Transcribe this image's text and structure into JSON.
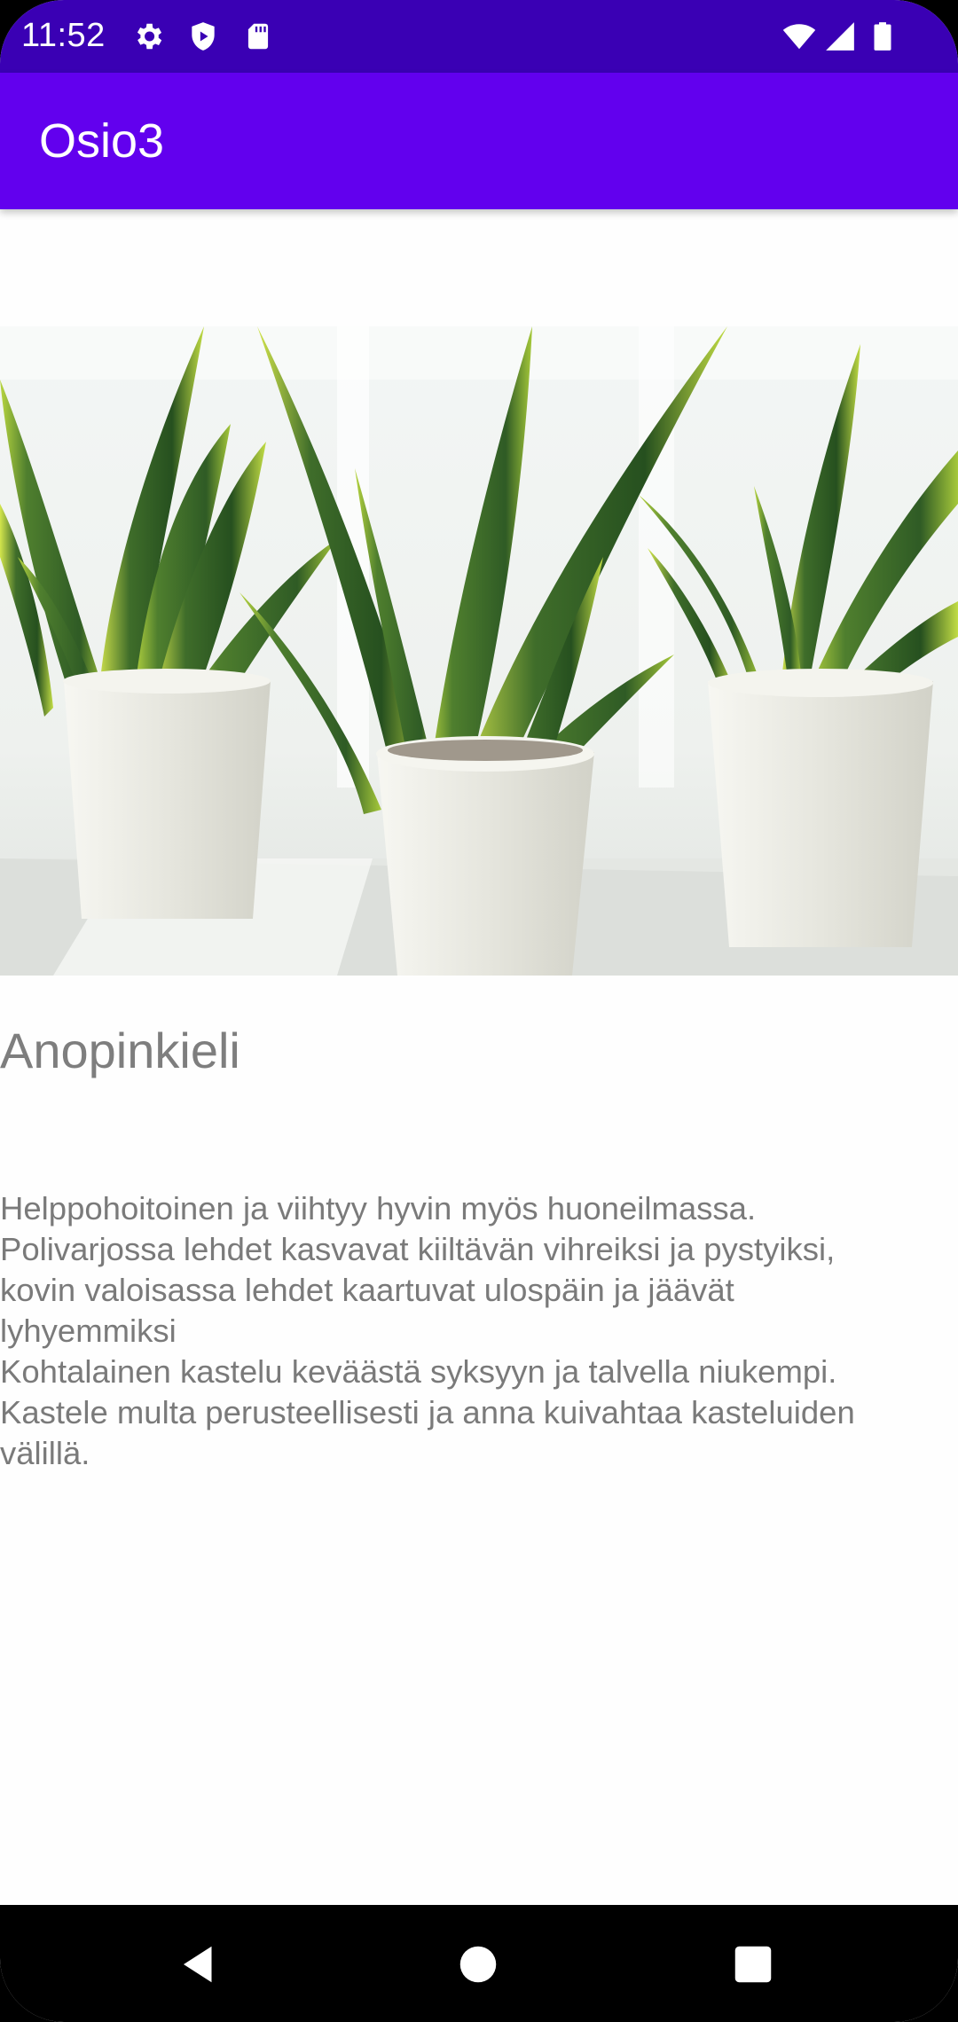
{
  "status_bar": {
    "time": "11:52",
    "background_color": "#3a00b4",
    "left_icons": [
      "settings-icon",
      "shield-play-icon",
      "sd-card-icon"
    ],
    "right_icons": [
      "wifi-icon",
      "cell-signal-icon",
      "battery-icon"
    ]
  },
  "app_bar": {
    "title": "Osio3",
    "background_color": "#6200ee"
  },
  "content": {
    "image_subject": "snake plants in white pots",
    "plant_name": "Anopinkieli",
    "description": "Helppohoitoinen ja viihtyy hyvin myös huoneilmassa.\nPolivarjossa lehdet kasvavat kiiltävän vihreiksi ja pystyiksi,\nkovin valoisassa lehdet kaartuvat ulospäin ja jäävät\nlyhyemmiksi\nKohtalainen kastelu keväästä syksyyn ja talvella niukempi.\nKastele multa perusteellisesti ja anna kuivahtaa kasteluiden\nvälillä."
  },
  "nav_bar": {
    "buttons": [
      "back-icon",
      "home-icon",
      "recents-icon"
    ]
  }
}
